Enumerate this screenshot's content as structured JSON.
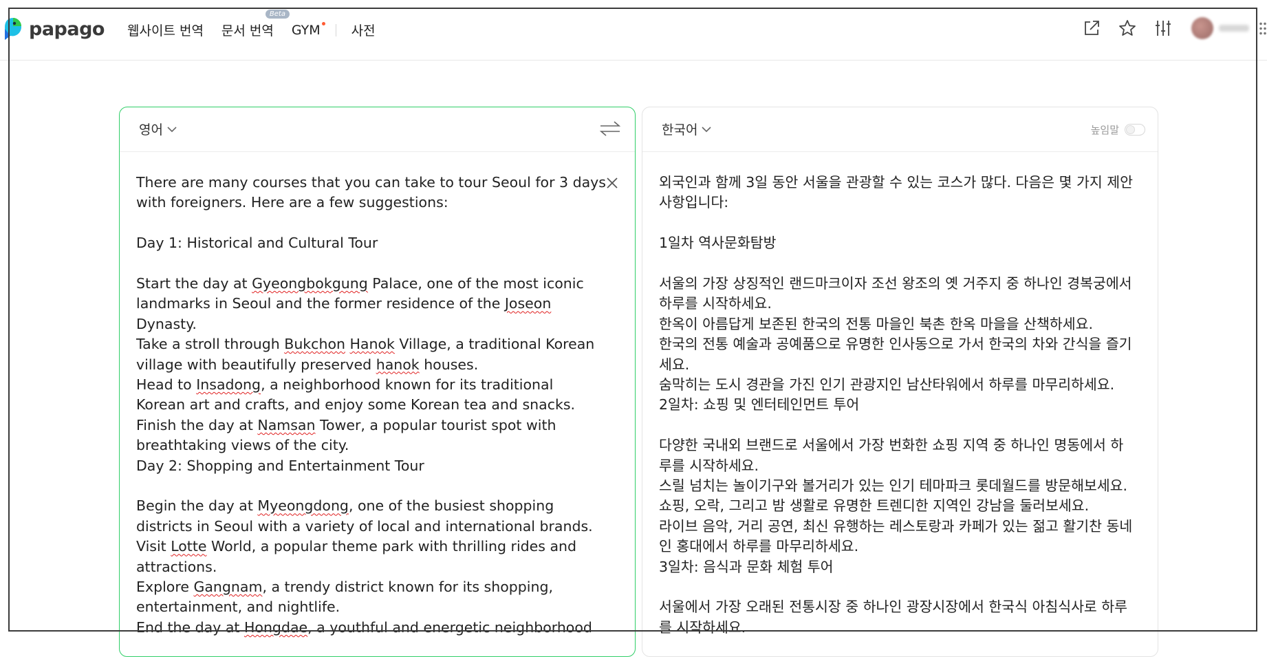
{
  "header": {
    "logo_text": "papago",
    "nav": [
      {
        "label": "웹사이트 번역"
      },
      {
        "label": "문서 번역",
        "badge": "Beta"
      },
      {
        "label": "GYM",
        "has_dot": true
      },
      {
        "label": "사전"
      }
    ],
    "icons": [
      "share-icon",
      "star-icon",
      "settings-sliders-icon"
    ]
  },
  "source": {
    "language": "영어",
    "lines": [
      [
        {
          "t": "There are many courses that you can take to tour Seoul for 3 days"
        }
      ],
      [
        {
          "t": "with foreigners. Here are a few suggestions:"
        }
      ],
      [],
      [
        {
          "t": "Day 1: Historical and Cultural Tour"
        }
      ],
      [],
      [
        {
          "t": "Start the day at "
        },
        {
          "t": "Gyeongbokgung",
          "s": true
        },
        {
          "t": " Palace, one of the most iconic"
        }
      ],
      [
        {
          "t": "landmarks in Seoul and the former residence of the "
        },
        {
          "t": "Joseon",
          "s": true
        }
      ],
      [
        {
          "t": "Dynasty."
        }
      ],
      [
        {
          "t": "Take a stroll through "
        },
        {
          "t": "Bukchon",
          "s": true
        },
        {
          "t": " "
        },
        {
          "t": "Hanok",
          "s": true
        },
        {
          "t": " Village, a traditional Korean"
        }
      ],
      [
        {
          "t": "village with beautifully preserved "
        },
        {
          "t": "hanok",
          "s": true
        },
        {
          "t": " houses."
        }
      ],
      [
        {
          "t": "Head to "
        },
        {
          "t": "Insadong",
          "s": true
        },
        {
          "t": ", a neighborhood known for its traditional"
        }
      ],
      [
        {
          "t": "Korean art and crafts, and enjoy some Korean tea and snacks."
        }
      ],
      [
        {
          "t": "Finish the day at "
        },
        {
          "t": "Namsan",
          "s": true
        },
        {
          "t": " Tower, a popular tourist spot with"
        }
      ],
      [
        {
          "t": "breathtaking views of the city."
        }
      ],
      [
        {
          "t": "Day 2: Shopping and Entertainment Tour"
        }
      ],
      [],
      [
        {
          "t": "Begin the day at "
        },
        {
          "t": "Myeongdong",
          "s": true
        },
        {
          "t": ", one of the busiest shopping"
        }
      ],
      [
        {
          "t": "districts in Seoul with a variety of local and international brands."
        }
      ],
      [
        {
          "t": "Visit "
        },
        {
          "t": "Lotte",
          "s": true
        },
        {
          "t": " World, a popular theme park with thrilling rides and"
        }
      ],
      [
        {
          "t": "attractions."
        }
      ],
      [
        {
          "t": "Explore "
        },
        {
          "t": "Gangnam",
          "s": true
        },
        {
          "t": ", a trendy district known for its shopping,"
        }
      ],
      [
        {
          "t": "entertainment, and nightlife."
        }
      ],
      [
        {
          "t": "End the day at "
        },
        {
          "t": "Hongdae",
          "s": true
        },
        {
          "t": ", a youthful and energetic neighborhood"
        }
      ]
    ]
  },
  "target": {
    "language": "한국어",
    "honorific_label": "높임말",
    "honorific_on": false,
    "lines": [
      "외국인과 함께 3일 동안 서울을 관광할 수 있는 코스가 많다. 다음은 몇 가지 제안",
      "사항입니다:",
      "",
      "1일차 역사문화탐방",
      "",
      "서울의 가장 상징적인 랜드마크이자 조선 왕조의 옛 거주지 중 하나인 경복궁에서",
      "하루를 시작하세요.",
      "한옥이 아름답게 보존된 한국의 전통 마을인 북촌 한옥 마을을 산책하세요.",
      "한국의 전통 예술과 공예품으로 유명한 인사동으로 가서 한국의 차와 간식을 즐기",
      "세요.",
      "숨막히는 도시 경관을 가진 인기 관광지인 남산타워에서 하루를 마무리하세요.",
      "2일차: 쇼핑 및 엔터테인먼트 투어",
      "",
      "다양한 국내외 브랜드로 서울에서 가장 번화한 쇼핑 지역 중 하나인 명동에서 하",
      "루를 시작하세요.",
      "스릴 넘치는 놀이기구와 볼거리가 있는 인기 테마파크 롯데월드를 방문해보세요.",
      "쇼핑, 오락, 그리고 밤 생활로 유명한 트렌디한 지역인 강남을 둘러보세요.",
      "라이브 음악, 거리 공연, 최신 유행하는 레스토랑과 카페가 있는 젊고 활기찬 동네",
      "인 홍대에서 하루를 마무리하세요.",
      "3일차: 음식과 문화 체험 투어",
      "",
      "서울에서 가장 오래된 전통시장 중 하나인 광장시장에서 한국식 아침식사로 하루",
      "를 시작하세요."
    ]
  },
  "colors": {
    "accent_green": "#2fce67",
    "spell_underline": "#e02020",
    "gym_dot": "#ff5a33"
  }
}
